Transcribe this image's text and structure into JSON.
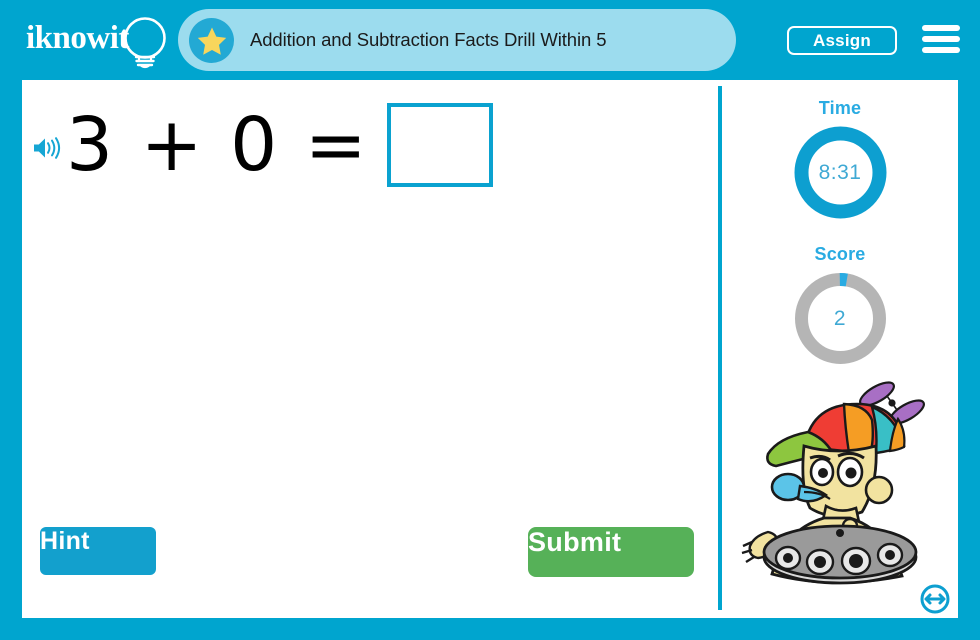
{
  "header": {
    "logo_text": "iknowit",
    "logo_icon": "lightbulb-icon",
    "star_icon": "star-icon",
    "title": "Addition and Subtraction Facts Drill Within 5",
    "assign_label": "Assign",
    "menu_icon": "hamburger-menu-icon",
    "brand_blue": "#00a5cf",
    "pill_blue": "#9cdcee",
    "star_yellow": "#f8d65c"
  },
  "question": {
    "speaker_icon": "speaker-icon",
    "expression": "3 + 0 =",
    "answer_value": "",
    "answer_placeholder": ""
  },
  "actions": {
    "hint_label": "Hint",
    "submit_label": "Submit",
    "hint_color": "#13a0cd",
    "submit_color": "#56b158"
  },
  "sidebar": {
    "time": {
      "label": "Time",
      "value": "8:31",
      "progress_percent": 100,
      "ring_color": "#0d9fd0",
      "track_color": "#0d9fd0"
    },
    "score": {
      "label": "Score",
      "value": "2",
      "progress_percent": 3,
      "ring_color": "#29abe2",
      "track_color": "#b5b5b5"
    },
    "mascot_icon": "robot-mascot-image",
    "resize_icon": "resize-horizontal-icon"
  }
}
